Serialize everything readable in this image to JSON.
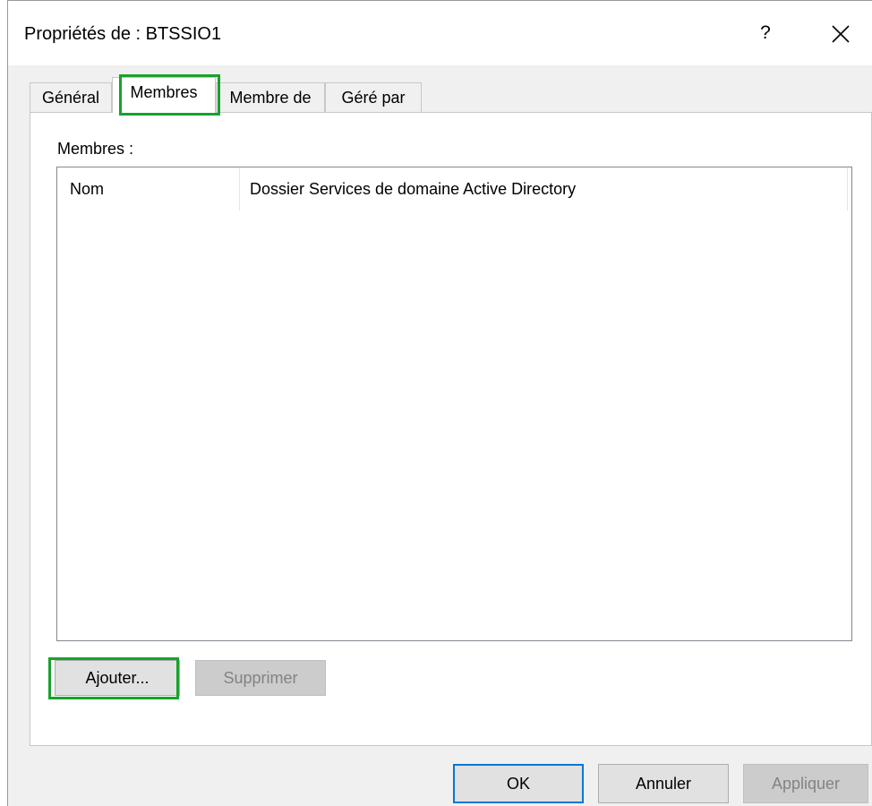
{
  "window": {
    "title": "Propriétés de : BTSSIO1",
    "help_label": "?"
  },
  "tabs": [
    {
      "label": "Général"
    },
    {
      "label": "Membres"
    },
    {
      "label": "Membre de"
    },
    {
      "label": "Géré par"
    }
  ],
  "members": {
    "label": "Membres :",
    "columns": [
      {
        "label": "Nom"
      },
      {
        "label": "Dossier Services de domaine Active Directory"
      }
    ],
    "rows": []
  },
  "buttons": {
    "add": "Ajouter...",
    "remove": "Supprimer",
    "ok": "OK",
    "cancel": "Annuler",
    "apply": "Appliquer"
  },
  "colors": {
    "highlight": "#17a22b",
    "default_button_border": "#0078d7"
  }
}
